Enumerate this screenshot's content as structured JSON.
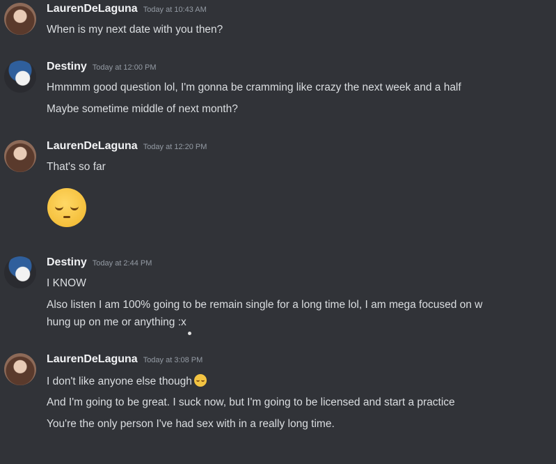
{
  "messages": [
    {
      "username": "LaurenDeLaguna",
      "timestamp": "Today at 10:43 AM",
      "lines": [
        "When is my next date with you then?"
      ]
    },
    {
      "username": "Destiny",
      "timestamp": "Today at 12:00 PM",
      "lines": [
        "Hmmmm good question lol, I'm gonna be cramming like crazy the next week and a half",
        "Maybe sometime middle of next month?"
      ]
    },
    {
      "username": "LaurenDeLaguna",
      "timestamp": "Today at 12:20 PM",
      "lines": [
        "That's so far"
      ],
      "emoji": "pensive-face-emoji"
    },
    {
      "username": "Destiny",
      "timestamp": "Today at 2:44 PM",
      "lines": [
        "I KNOW",
        "Also listen I am 100% going to be remain single for a long time lol, I am mega focused on w",
        "hung up on me or anything :x"
      ]
    },
    {
      "username": "LaurenDeLaguna",
      "timestamp": "Today at 3:08 PM",
      "lines": [
        "I don't like anyone else though",
        "And I'm going to be great. I suck now, but I'm going to be licensed and start a practice",
        "You're the only person I've had sex with in a really long time."
      ]
    }
  ],
  "colors": {
    "background": "#313338",
    "username": "#f2f3f5",
    "timestamp": "#949ba4",
    "text": "#dbdee1"
  }
}
